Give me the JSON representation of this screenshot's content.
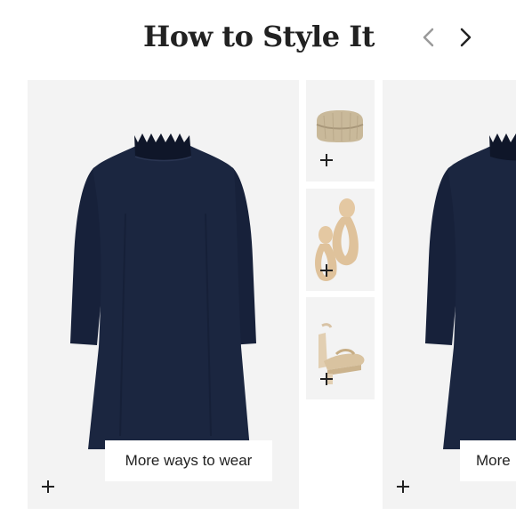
{
  "header": {
    "title": "How to Style It",
    "prev_icon": "chevron-left-icon",
    "next_icon": "chevron-right-icon"
  },
  "looks": [
    {
      "product": "navy ruffle-neck long-sleeve shift dress",
      "more_label": "More ways to wear",
      "accessories": [
        {
          "item": "woven clutch bag"
        },
        {
          "item": "woven teardrop drop earrings"
        },
        {
          "item": "metallic platform ankle-strap sandals"
        }
      ]
    },
    {
      "more_label": "More"
    }
  ],
  "colors": {
    "card_bg": "#f3f3f3",
    "dress": "#1b2640",
    "text": "#222222"
  }
}
